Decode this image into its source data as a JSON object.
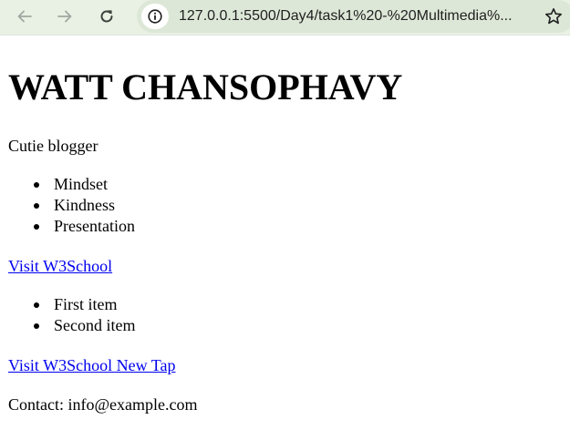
{
  "browser": {
    "url": "127.0.0.1:5500/Day4/task1%20-%20Multimedia%...",
    "icons": {
      "back": "arrow-left-icon",
      "forward": "arrow-right-icon",
      "reload": "reload-icon",
      "site_info": "info-icon",
      "bookmark": "star-icon"
    }
  },
  "page": {
    "title": "WATT CHANSOPHAVY",
    "subtitle": "Cutie blogger",
    "skills": [
      "Mindset",
      "Kindness",
      "Presentation"
    ],
    "link1": "Visit W3School",
    "items": [
      "First item",
      "Second item"
    ],
    "link2": "Visit W3School New Tap",
    "contact": "Contact: info@example.com"
  },
  "colors": {
    "toolbar_bg": "#e9f1e4",
    "omnibox_bg": "#dde7d7",
    "link": "#0000ee"
  }
}
